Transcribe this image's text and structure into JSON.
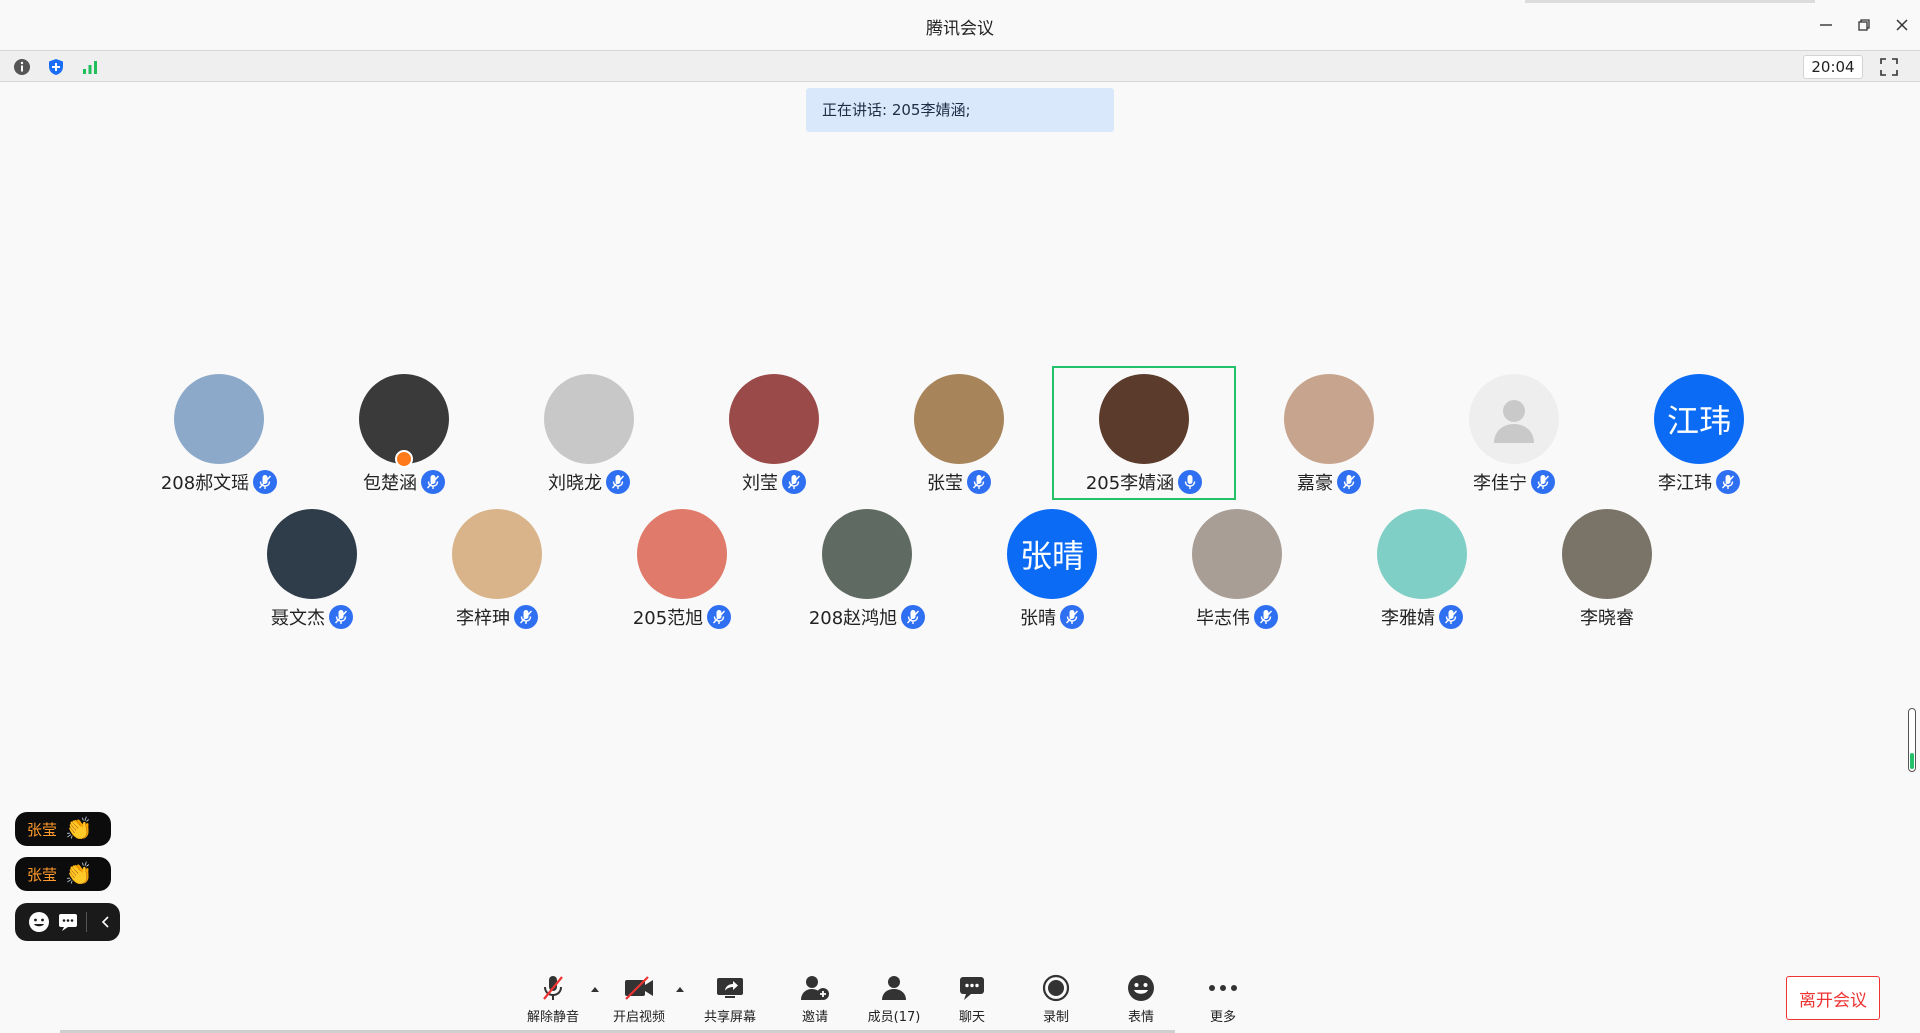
{
  "window": {
    "title": "腾讯会议"
  },
  "infobar": {
    "time": "20:04"
  },
  "speaking": {
    "text": "正在讲话: 205李婧涵;"
  },
  "participants": [
    {
      "name": "208郝文瑶",
      "row": 1,
      "col": 0,
      "bg": "#8da9c9"
    },
    {
      "name": "包楚涵",
      "row": 1,
      "col": 1,
      "bg": "#3a3a3a",
      "host": true
    },
    {
      "name": "刘晓龙",
      "row": 1,
      "col": 2,
      "bg": "#c8c8c8"
    },
    {
      "name": "刘莹",
      "row": 1,
      "col": 3,
      "bg": "#9b4a4a"
    },
    {
      "name": "张莹",
      "row": 1,
      "col": 4,
      "bg": "#a8845a"
    },
    {
      "name": "205李婧涵",
      "row": 1,
      "col": 5,
      "bg": "#5b3b2b",
      "active": true
    },
    {
      "name": "嘉豪",
      "row": 1,
      "col": 6,
      "bg": "#c7a48d"
    },
    {
      "name": "李佳宁",
      "row": 1,
      "col": 7,
      "bg": "#eeeeee",
      "placeholder": true
    },
    {
      "name": "李江玮",
      "row": 1,
      "col": 8,
      "bg": "#0b6bf5",
      "initials": "江玮"
    },
    {
      "name": "聂文杰",
      "row": 2,
      "col": 0,
      "bg": "#2f3c4a"
    },
    {
      "name": "李梓珅",
      "row": 2,
      "col": 1,
      "bg": "#d9b48a"
    },
    {
      "name": "205范旭",
      "row": 2,
      "col": 2,
      "bg": "#e07a6a"
    },
    {
      "name": "208赵鸿旭",
      "row": 2,
      "col": 3,
      "bg": "#5f6a62"
    },
    {
      "name": "张晴",
      "row": 2,
      "col": 4,
      "bg": "#0b6bf5",
      "initials": "张晴"
    },
    {
      "name": "毕志伟",
      "row": 2,
      "col": 5,
      "bg": "#a89e96"
    },
    {
      "name": "李雅婧",
      "row": 2,
      "col": 6,
      "bg": "#7fcfc6"
    },
    {
      "name": "李晓睿",
      "row": 2,
      "col": 7,
      "bg": "#7a7468",
      "nomic": true
    }
  ],
  "reactions": [
    {
      "name": "张莹",
      "emoji": "👏"
    },
    {
      "name": "张莹",
      "emoji": "👏"
    }
  ],
  "toolbar": {
    "unmute": "解除静音",
    "start_video": "开启视频",
    "share_screen": "共享屏幕",
    "invite": "邀请",
    "members": "成员(17)",
    "chat": "聊天",
    "record": "录制",
    "emoji": "表情",
    "more": "更多",
    "leave": "离开会议"
  },
  "colors": {
    "accent": "#2f6ff2",
    "active_border": "#22c26a",
    "leave": "#ee3333"
  }
}
